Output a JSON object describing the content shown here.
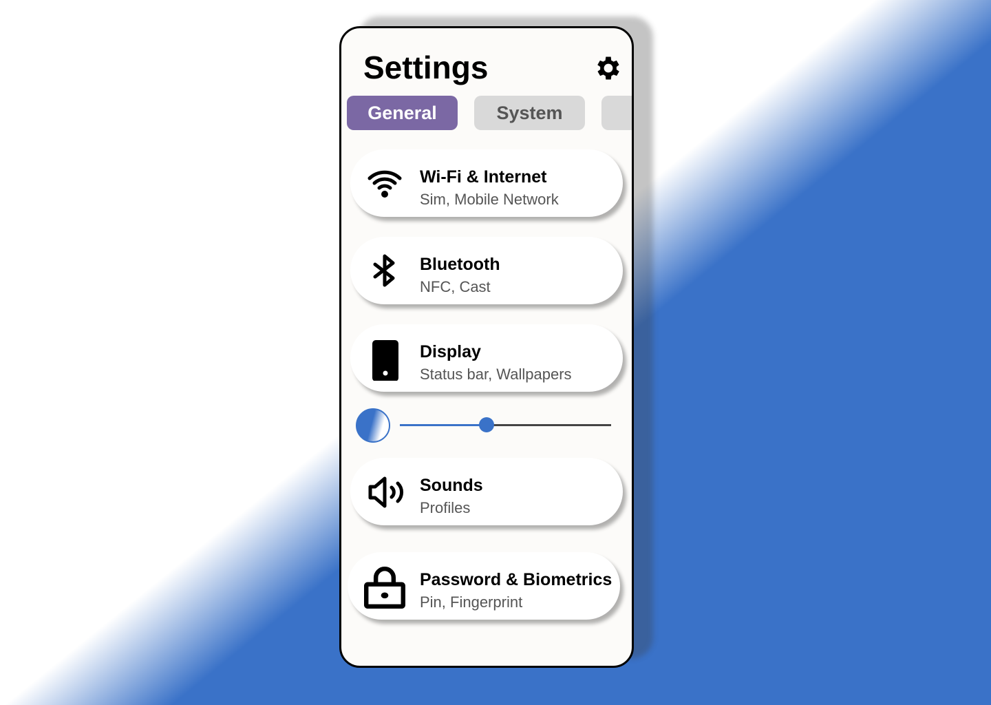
{
  "header": {
    "title": "Settings",
    "icon": "gear-icon"
  },
  "tabs": [
    {
      "label": "General",
      "active": true
    },
    {
      "label": "System",
      "active": false
    },
    {
      "label": "",
      "active": false
    }
  ],
  "items": [
    {
      "name": "Wi-Fi & Internet",
      "sub": "Sim, Mobile Network",
      "icon": "wifi-icon"
    },
    {
      "name": "Bluetooth",
      "sub": "NFC, Cast",
      "icon": "bluetooth-icon"
    },
    {
      "name": "Display",
      "sub": "Status bar, Wallpapers",
      "icon": "phone-icon"
    },
    {
      "name": "Sounds",
      "sub": "Profiles",
      "icon": "speaker-icon"
    },
    {
      "name": "Password & Biometrics",
      "sub": "Pin, Fingerprint",
      "icon": "lock-icon"
    }
  ],
  "brightness": {
    "value": 0.41,
    "icon": "brightness-icon"
  },
  "colors": {
    "accent": "#7b68a4",
    "blue": "#3a72c8",
    "tab_inactive": "#d9d9d9"
  }
}
